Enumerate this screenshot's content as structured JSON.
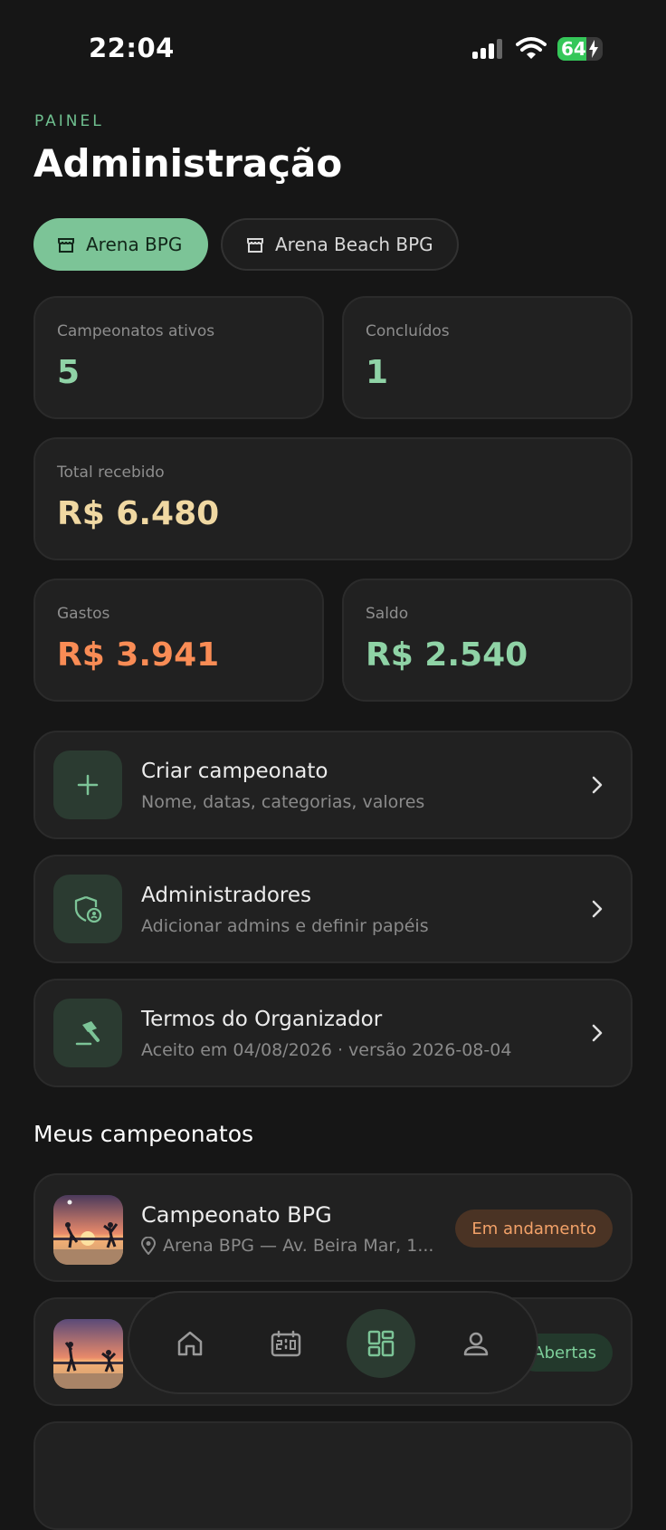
{
  "status_bar": {
    "time": "22:04",
    "battery": "64",
    "battery_level": 0.64
  },
  "header": {
    "eyebrow": "PAINEL",
    "title": "Administração"
  },
  "venues": [
    {
      "label": "Arena BPG",
      "active": true
    },
    {
      "label": "Arena Beach BPG",
      "active": false
    }
  ],
  "stats": {
    "active": {
      "label": "Campeonatos ativos",
      "value": "5"
    },
    "completed": {
      "label": "Concluídos",
      "value": "1"
    },
    "received": {
      "label": "Total recebido",
      "value": "R$ 6.480"
    },
    "expenses": {
      "label": "Gastos",
      "value": "R$ 3.941"
    },
    "balance": {
      "label": "Saldo",
      "value": "R$ 2.540"
    }
  },
  "actions": [
    {
      "title": "Criar campeonato",
      "subtitle": "Nome, datas, categorias, valores",
      "icon": "plus-icon"
    },
    {
      "title": "Administradores",
      "subtitle": "Adicionar admins e definir papéis",
      "icon": "shield-user-icon"
    },
    {
      "title": "Termos do Organizador",
      "subtitle": "Aceito em 04/08/2026 · versão 2026-08-04",
      "icon": "gavel-icon"
    }
  ],
  "section_title": "Meus campeonatos",
  "championships": [
    {
      "name": "Campeonato BPG",
      "location": "Arena BPG — Av. Beira Mar, 1...",
      "status": "Em andamento"
    },
    {
      "name": "",
      "location": "",
      "status": "Abertas"
    }
  ],
  "nav": [
    "home-icon",
    "scoreboard-icon",
    "dashboard-icon",
    "profile-icon"
  ],
  "colors": {
    "accent": "#7cc497",
    "stat_green": "#8fd3a6",
    "received": "#f0d8a2",
    "expenses": "#f98c55",
    "background": "#161616",
    "card": "#212121"
  }
}
